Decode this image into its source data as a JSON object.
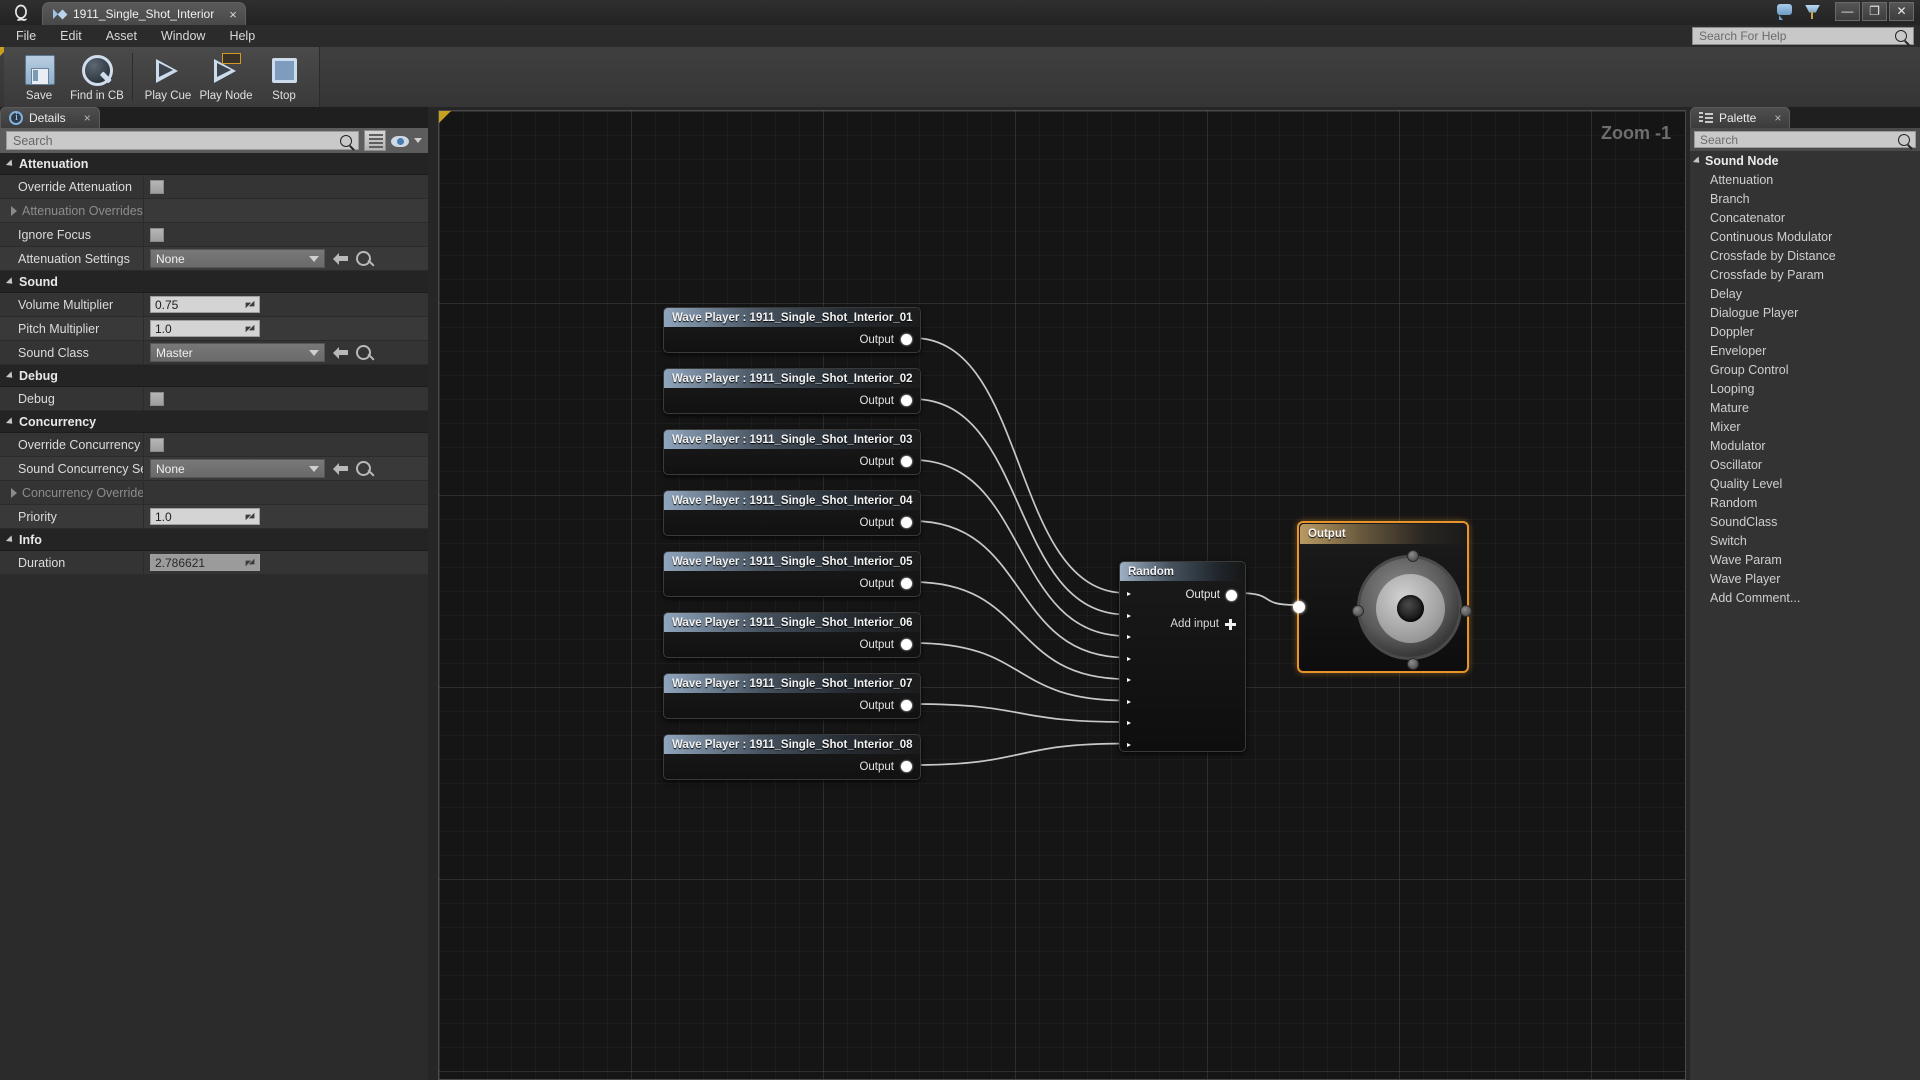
{
  "window": {
    "logo": "ue-logo",
    "tab_title": "1911_Single_Shot_Interior",
    "tab_close": "×",
    "minimize": "—",
    "restore": "❐",
    "close": "✕"
  },
  "menubar": {
    "items": [
      "File",
      "Edit",
      "Asset",
      "Window",
      "Help"
    ],
    "help_search_placeholder": "Search For Help"
  },
  "toolbar": {
    "buttons": [
      {
        "label": "Save",
        "icon": "floppy-disk-icon"
      },
      {
        "label": "Find in CB",
        "icon": "magnifier-icon"
      },
      {
        "label": "Play Cue",
        "icon": "play-icon"
      },
      {
        "label": "Play Node",
        "icon": "play-node-icon"
      },
      {
        "label": "Stop",
        "icon": "stop-icon"
      }
    ]
  },
  "details": {
    "tab_label": "Details",
    "tab_close": "×",
    "search_placeholder": "Search",
    "categories": [
      {
        "name": "Attenuation",
        "rows": [
          {
            "label": "Override Attenuation",
            "type": "checkbox",
            "value": "",
            "dim": false
          },
          {
            "label": "Attenuation Overrides",
            "type": "expander",
            "value": "",
            "dim": true
          },
          {
            "label": "Ignore Focus",
            "type": "checkbox",
            "value": "",
            "dim": false
          },
          {
            "label": "Attenuation Settings",
            "type": "combo",
            "value": "None",
            "dim": false
          }
        ]
      },
      {
        "name": "Sound",
        "rows": [
          {
            "label": "Volume Multiplier",
            "type": "number",
            "value": "0.75",
            "dim": false
          },
          {
            "label": "Pitch Multiplier",
            "type": "number",
            "value": "1.0",
            "dim": false
          },
          {
            "label": "Sound Class",
            "type": "combo",
            "value": "Master",
            "dim": false
          }
        ]
      },
      {
        "name": "Debug",
        "rows": [
          {
            "label": "Debug",
            "type": "checkbox",
            "value": "",
            "dim": false
          }
        ]
      },
      {
        "name": "Concurrency",
        "rows": [
          {
            "label": "Override Concurrency",
            "type": "checkbox",
            "value": "",
            "dim": false
          },
          {
            "label": "Sound Concurrency Setti",
            "type": "combo",
            "value": "None",
            "dim": false
          },
          {
            "label": "Concurrency Overrides",
            "type": "expander",
            "value": "",
            "dim": true
          },
          {
            "label": "Priority",
            "type": "number",
            "value": "1.0",
            "dim": false
          }
        ]
      },
      {
        "name": "Info",
        "rows": [
          {
            "label": "Duration",
            "type": "number-readonly",
            "value": "2.786621",
            "dim": false
          }
        ]
      }
    ]
  },
  "graph": {
    "zoom_label": "Zoom -1",
    "wave_nodes": [
      {
        "title": "Wave Player : 1911_Single_Shot_Interior_01",
        "output_label": "Output"
      },
      {
        "title": "Wave Player : 1911_Single_Shot_Interior_02",
        "output_label": "Output"
      },
      {
        "title": "Wave Player : 1911_Single_Shot_Interior_03",
        "output_label": "Output"
      },
      {
        "title": "Wave Player : 1911_Single_Shot_Interior_04",
        "output_label": "Output"
      },
      {
        "title": "Wave Player : 1911_Single_Shot_Interior_05",
        "output_label": "Output"
      },
      {
        "title": "Wave Player : 1911_Single_Shot_Interior_06",
        "output_label": "Output"
      },
      {
        "title": "Wave Player : 1911_Single_Shot_Interior_07",
        "output_label": "Output"
      },
      {
        "title": "Wave Player : 1911_Single_Shot_Interior_08",
        "output_label": "Output"
      }
    ],
    "random_node": {
      "title": "Random",
      "output_label": "Output",
      "add_input_label": "Add input",
      "input_count": 8
    },
    "output_node": {
      "title": "Output",
      "icon": "speaker-icon",
      "selected_color": "#e7952a"
    }
  },
  "palette": {
    "tab_label": "Palette",
    "tab_close": "×",
    "search_placeholder": "Search",
    "group_label": "Sound Node",
    "items": [
      "Attenuation",
      "Branch",
      "Concatenator",
      "Continuous Modulator",
      "Crossfade by Distance",
      "Crossfade by Param",
      "Delay",
      "Dialogue Player",
      "Doppler",
      "Enveloper",
      "Group Control",
      "Looping",
      "Mature",
      "Mixer",
      "Modulator",
      "Oscillator",
      "Quality Level",
      "Random",
      "SoundClass",
      "Switch",
      "Wave Param",
      "Wave Player",
      "Add Comment..."
    ]
  }
}
